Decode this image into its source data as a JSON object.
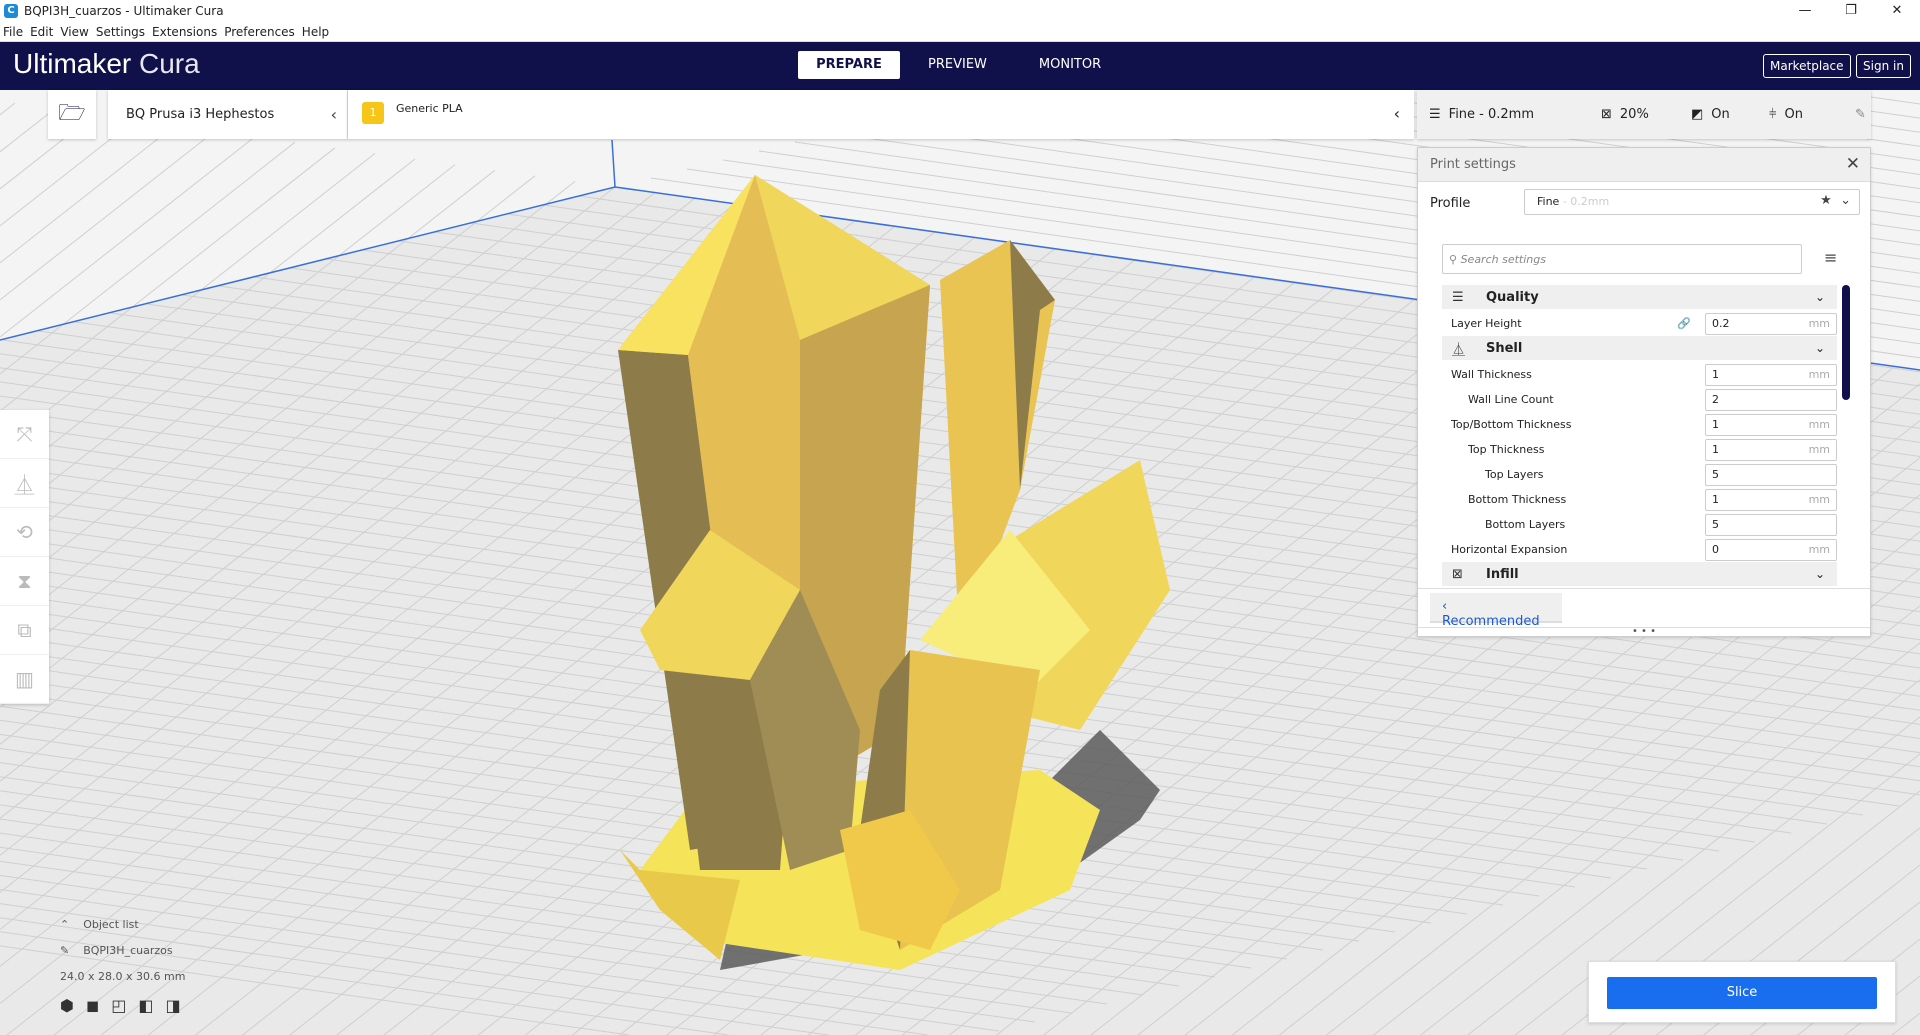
{
  "window": {
    "title": "BQPI3H_cuarzos - Ultimaker Cura",
    "app_icon": "C",
    "controls": [
      "—",
      "❐",
      "✕"
    ]
  },
  "menu": [
    "File",
    "Edit",
    "View",
    "Settings",
    "Extensions",
    "Preferences",
    "Help"
  ],
  "header": {
    "logo_brand": "Ultimaker",
    "logo_product": "Cura",
    "tabs": [
      "PREPARE",
      "PREVIEW",
      "MONITOR"
    ],
    "active_tab": "PREPARE",
    "marketplace": "Marketplace",
    "signin": "Sign in"
  },
  "printer": {
    "name": "BQ Prusa i3 Hephestos"
  },
  "material": {
    "extruder": "1",
    "name": "Generic PLA"
  },
  "summary": {
    "profile": "Fine - 0.2mm",
    "infill": "20%",
    "support": "On",
    "adhesion": "On"
  },
  "print_settings": {
    "title": "Print settings",
    "profile_label": "Profile",
    "profile_name": "Fine",
    "profile_suffix": " - 0.2mm",
    "search_placeholder": "Search settings",
    "categories": [
      {
        "name": "Quality",
        "rows": [
          {
            "label": "Layer Height",
            "value": "0.2",
            "unit": "mm",
            "indent": 0
          }
        ]
      },
      {
        "name": "Shell",
        "rows": [
          {
            "label": "Wall Thickness",
            "value": "1",
            "unit": "mm",
            "indent": 0
          },
          {
            "label": "Wall Line Count",
            "value": "2",
            "unit": "",
            "indent": 1
          },
          {
            "label": "Top/Bottom Thickness",
            "value": "1",
            "unit": "mm",
            "indent": 0
          },
          {
            "label": "Top Thickness",
            "value": "1",
            "unit": "mm",
            "indent": 1
          },
          {
            "label": "Top Layers",
            "value": "5",
            "unit": "",
            "indent": 2
          },
          {
            "label": "Bottom Thickness",
            "value": "1",
            "unit": "mm",
            "indent": 1
          },
          {
            "label": "Bottom Layers",
            "value": "5",
            "unit": "",
            "indent": 2
          },
          {
            "label": "Horizontal Expansion",
            "value": "0",
            "unit": "mm",
            "indent": 0
          }
        ]
      },
      {
        "name": "Infill",
        "rows": []
      }
    ],
    "recommended": "Recommended"
  },
  "object_list": {
    "title": "Object list",
    "object_name": "BQPI3H_cuarzos",
    "dimensions": "24.0 x 28.0 x 30.6 mm"
  },
  "slice": {
    "label": "Slice"
  },
  "colors": {
    "header": "#10104a",
    "accent": "#196ef0",
    "model": "#f5d85a"
  }
}
